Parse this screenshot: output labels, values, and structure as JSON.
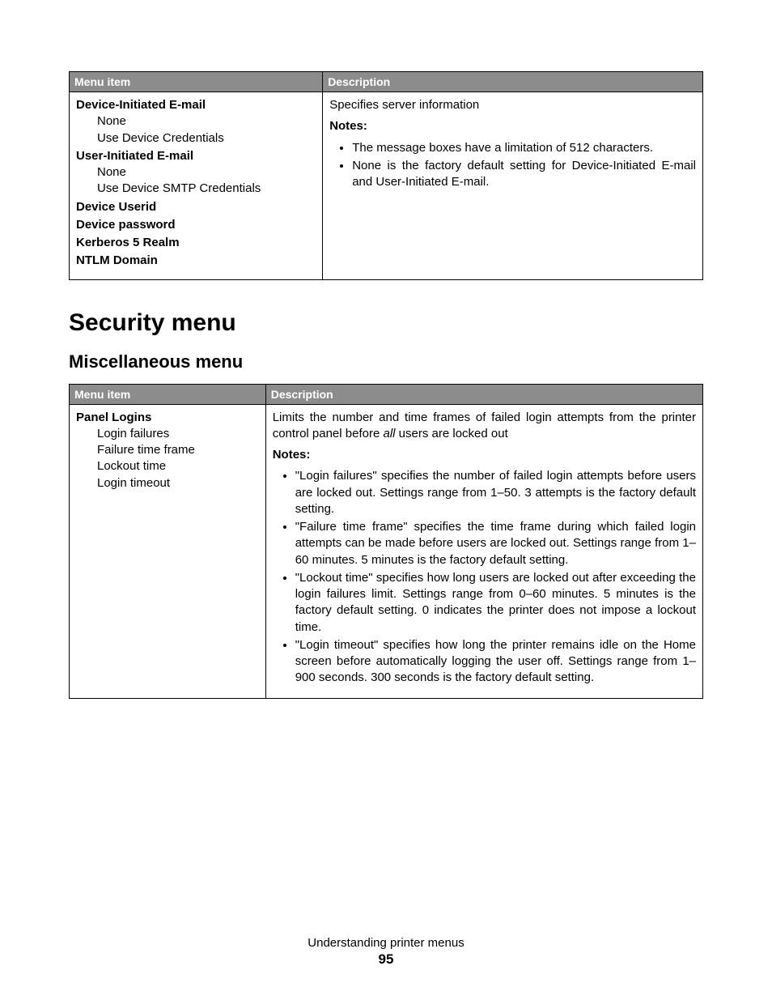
{
  "table1": {
    "headers": {
      "menuItem": "Menu item",
      "description": "Description"
    },
    "menuColumn": {
      "groups": [
        {
          "bold": "Device-Initiated E-mail",
          "items": [
            "None",
            "Use Device Credentials"
          ]
        },
        {
          "bold": "User-Initiated E-mail",
          "items": [
            "None",
            "Use Device SMTP Credentials"
          ]
        },
        {
          "bold": "Device Userid",
          "items": []
        },
        {
          "bold": "Device password",
          "items": []
        },
        {
          "bold": "Kerberos 5 Realm",
          "items": []
        },
        {
          "bold": "NTLM Domain",
          "items": []
        }
      ]
    },
    "descColumn": {
      "lead": "Specifies server information",
      "notesLabel": "Notes:",
      "notes": [
        "The message boxes have a limitation of 512 characters.",
        "None is the factory default setting for Device-Initiated E-mail and User-Initiated E-mail."
      ]
    }
  },
  "headings": {
    "security": "Security menu",
    "misc": "Miscellaneous menu"
  },
  "table2": {
    "headers": {
      "menuItem": "Menu item",
      "description": "Description"
    },
    "menuColumn": {
      "bold": "Panel Logins",
      "items": [
        "Login failures",
        "Failure time frame",
        "Lockout time",
        "Login timeout"
      ]
    },
    "descColumn": {
      "leadPre": "Limits the number and time frames of failed login attempts from the printer control panel before ",
      "leadItalic": "all",
      "leadPost": " users are locked out",
      "notesLabel": "Notes:",
      "notes": [
        "\"Login failures\" specifies the number of failed login attempts before users are locked out. Settings range from 1–50. 3 attempts is the factory default setting.",
        "\"Failure time frame\" specifies the time frame during which failed login attempts can be made before users are locked out. Settings range from 1–60 minutes. 5 minutes is the factory default setting.",
        "\"Lockout time\" specifies how long users are locked out after exceeding the login failures limit. Settings range from 0–60 minutes. 5 minutes is the factory default setting. 0 indicates the printer does not impose a lockout time.",
        "\"Login timeout\" specifies how long the printer remains idle on the Home screen before automatically logging the user off. Settings range from 1–900 seconds. 300 seconds is the factory default setting."
      ]
    }
  },
  "footer": {
    "title": "Understanding printer menus",
    "page": "95"
  }
}
